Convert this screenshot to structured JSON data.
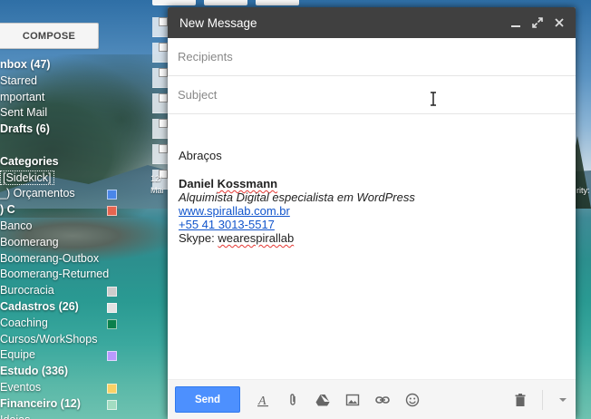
{
  "compose_button": "COMPOSE",
  "nav": [
    {
      "label": "nbox (47)",
      "bold": true
    },
    {
      "label": "Starred"
    },
    {
      "label": "mportant"
    },
    {
      "label": "Sent Mail"
    },
    {
      "label": "Drafts (6)",
      "bold": true
    },
    {
      "label": "▸",
      "spacer": true
    },
    {
      "label": "Categories",
      "bold": true
    },
    {
      "label": "[Sidekick]",
      "boxed": true
    },
    {
      "label": "_) Orçamentos",
      "color": "#4a86e8"
    },
    {
      "label": ") C",
      "bold": true,
      "color": "#e66550"
    },
    {
      "label": "Banco"
    },
    {
      "label": "Boomerang"
    },
    {
      "label": "Boomerang-Outbox"
    },
    {
      "label": "Boomerang-Returned"
    },
    {
      "label": "Burocracia",
      "color": "#cccccc"
    },
    {
      "label": "Cadastros (26)",
      "bold": true,
      "color": "#e3e3e3"
    },
    {
      "label": "Coaching",
      "color": "#0b804b"
    },
    {
      "label": "Cursos/WorkShops"
    },
    {
      "label": "Equipe",
      "color": "#b99aff"
    },
    {
      "label": "Estudo (336)",
      "bold": true
    },
    {
      "label": "Eventos",
      "color": "#fad165"
    },
    {
      "label": "Financeiro (12)",
      "bold": true,
      "color": "#a2dcc1"
    },
    {
      "label": "Idoias"
    }
  ],
  "bg_fragments": {
    "left": "12/",
    "left2": "Mai",
    "right": "rity:"
  },
  "compose": {
    "title": "New Message",
    "minimize_icon": "minimize-icon",
    "popout_icon": "expand-icon",
    "close_icon": "close-icon",
    "recipients_placeholder": "Recipients",
    "subject_placeholder": "Subject",
    "greeting": "Abraços",
    "signature": {
      "name_first": "Daniel ",
      "name_last": "Kossmann",
      "tagline": "Alquimista Digital especialista em WordPress",
      "website": "www.spirallab.com.br",
      "phone": "+55 41 3013-5517",
      "skype_label": "Skype: ",
      "skype_handle": "wearespirallab"
    },
    "send_label": "Send"
  },
  "colors": {
    "accent": "#4d90fe",
    "header": "#404040",
    "link": "#1155cc"
  }
}
